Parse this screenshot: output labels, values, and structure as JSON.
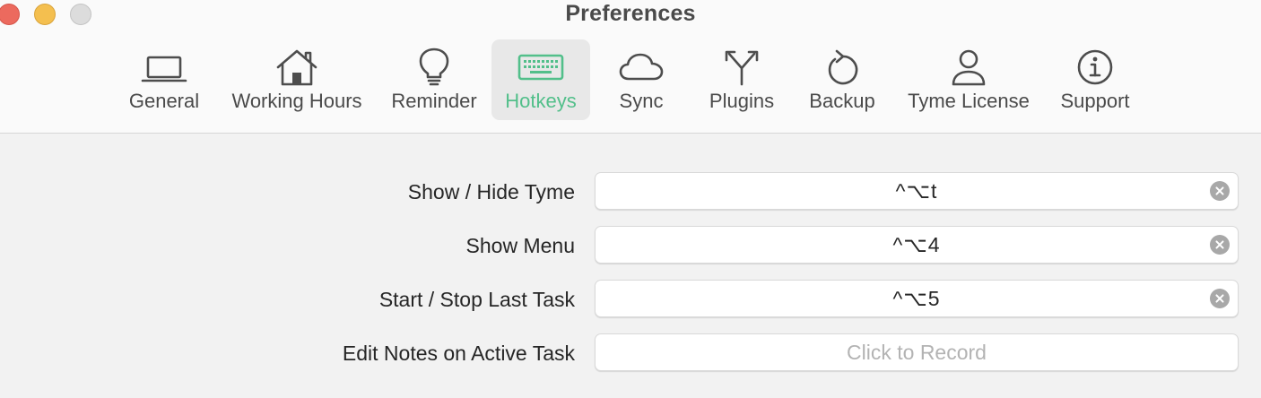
{
  "window": {
    "title": "Preferences"
  },
  "toolbar": {
    "tabs": [
      {
        "id": "general",
        "label": "General",
        "icon": "laptop-icon",
        "selected": false
      },
      {
        "id": "working-hours",
        "label": "Working Hours",
        "icon": "house-icon",
        "selected": false
      },
      {
        "id": "reminder",
        "label": "Reminder",
        "icon": "lightbulb-icon",
        "selected": false
      },
      {
        "id": "hotkeys",
        "label": "Hotkeys",
        "icon": "keyboard-icon",
        "selected": true
      },
      {
        "id": "sync",
        "label": "Sync",
        "icon": "cloud-icon",
        "selected": false
      },
      {
        "id": "plugins",
        "label": "Plugins",
        "icon": "fork-arrows-icon",
        "selected": false
      },
      {
        "id": "backup",
        "label": "Backup",
        "icon": "restore-arrow-icon",
        "selected": false
      },
      {
        "id": "tyme-license",
        "label": "Tyme License",
        "icon": "person-icon",
        "selected": false
      },
      {
        "id": "support",
        "label": "Support",
        "icon": "info-icon",
        "selected": false
      }
    ],
    "accent_color": "#52bf8a"
  },
  "hotkeys": [
    {
      "label": "Show / Hide Tyme",
      "value": "^⌥t",
      "placeholder": "",
      "has_clear": true
    },
    {
      "label": "Show Menu",
      "value": "^⌥4",
      "placeholder": "",
      "has_clear": true
    },
    {
      "label": "Start / Stop Last Task",
      "value": "^⌥5",
      "placeholder": "",
      "has_clear": true
    },
    {
      "label": "Edit Notes on Active Task",
      "value": "",
      "placeholder": "Click to Record",
      "has_clear": false
    }
  ]
}
